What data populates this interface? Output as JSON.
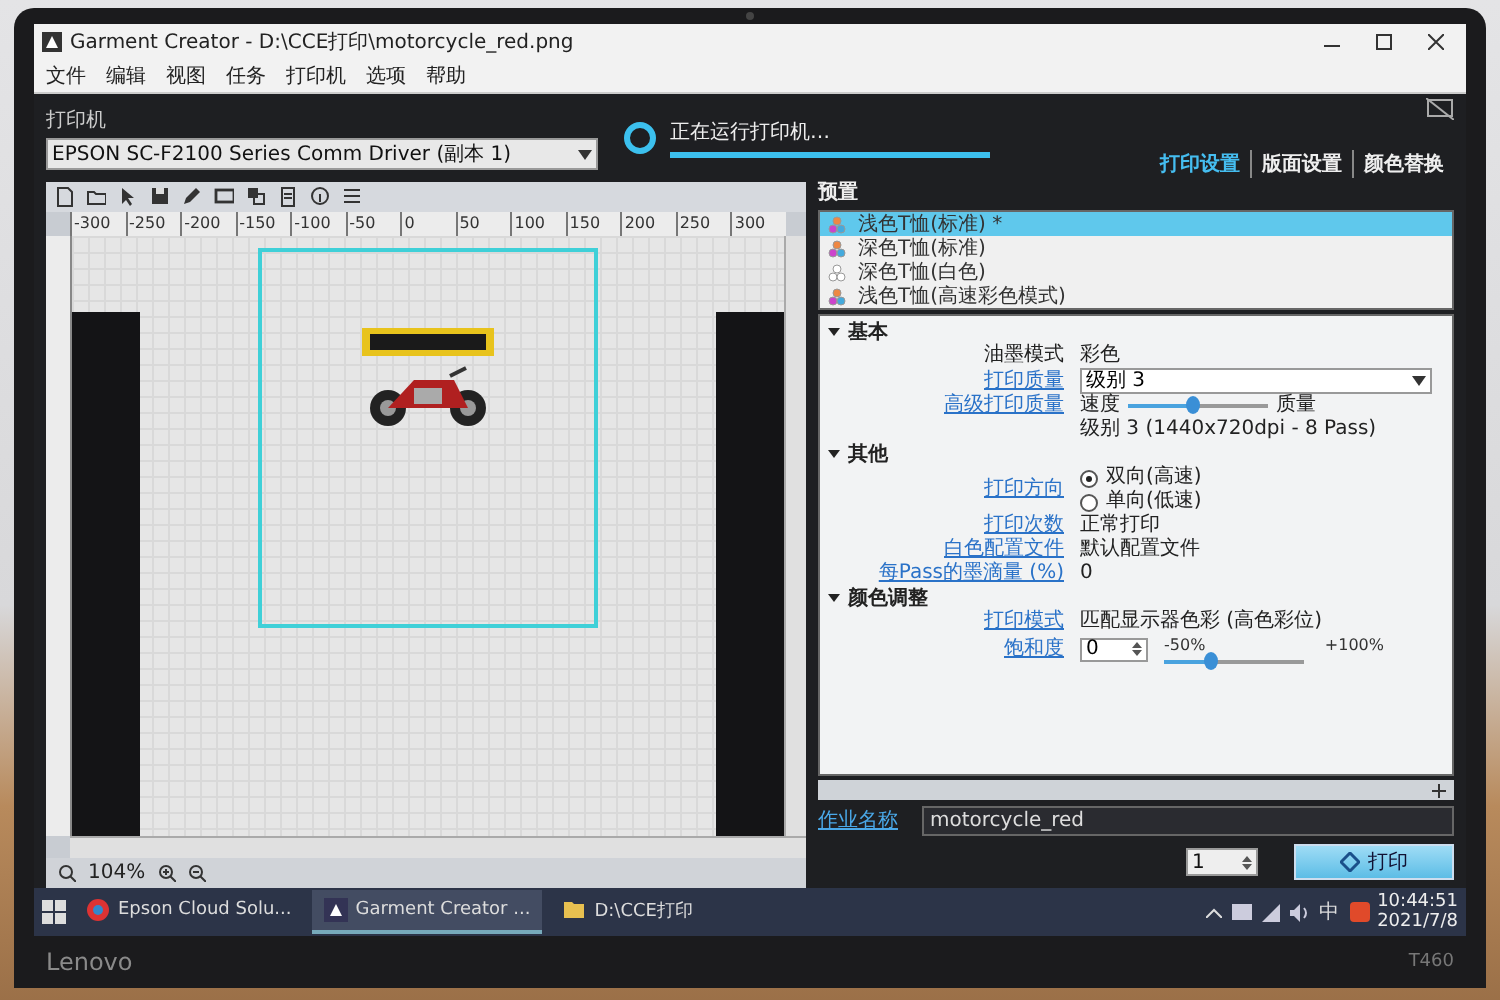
{
  "laptop": {
    "brand": "Lenovo",
    "model": "T460"
  },
  "window": {
    "title": "Garment Creator - D:\\CCE打印\\motorcycle_red.png"
  },
  "menu": [
    "文件",
    "编辑",
    "视图",
    "任务",
    "打印机",
    "选项",
    "帮助"
  ],
  "printer": {
    "label": "打印机",
    "value": "EPSON SC-F2100 Series Comm Driver (副本 1)"
  },
  "progress": {
    "text": "正在运行打印机…",
    "level": 1
  },
  "tabs": [
    {
      "label": "打印设置",
      "selected": true
    },
    {
      "label": "版面设置",
      "selected": false
    },
    {
      "label": "颜色替换",
      "selected": false
    }
  ],
  "canvas": {
    "ruler": [
      "-300",
      "-250",
      "-200",
      "-150",
      "-100",
      "-50",
      "0",
      "50",
      "100",
      "150",
      "200",
      "250",
      "300"
    ],
    "zoom": "104%"
  },
  "presets": {
    "label": "预置",
    "items": [
      {
        "label": "浅色T恤(标准) *",
        "selected": true
      },
      {
        "label": "深色T恤(标准)",
        "selected": false
      },
      {
        "label": "深色T恤(白色)",
        "selected": false
      },
      {
        "label": "浅色T恤(高速彩色模式)",
        "selected": false
      }
    ]
  },
  "settings": [
    {
      "title": "基本",
      "expanded": true,
      "rows": [
        {
          "kind": "text",
          "link": false,
          "label": "油墨模式",
          "value": "彩色"
        },
        {
          "kind": "select",
          "link": true,
          "label": "打印质量",
          "value": "级别 3"
        },
        {
          "kind": "slider",
          "link": true,
          "label": "高级打印质量",
          "min_label": "速度",
          "max_label": "质量",
          "level": 0.45
        },
        {
          "kind": "note",
          "value": "级别 3 (1440x720dpi - 8 Pass)"
        }
      ]
    },
    {
      "title": "其他",
      "expanded": true,
      "rows": [
        {
          "kind": "radio",
          "link": true,
          "label": "打印方向",
          "options": [
            {
              "label": "双向(高速)",
              "selected": true
            },
            {
              "label": "单向(低速)",
              "selected": false
            }
          ]
        },
        {
          "kind": "text",
          "link": true,
          "label": "打印次数",
          "value": "正常打印"
        },
        {
          "kind": "text",
          "link": true,
          "label": "白色配置文件",
          "value": "默认配置文件"
        },
        {
          "kind": "text",
          "link": true,
          "label": "每Pass的墨滴量 (%)",
          "value": "0"
        }
      ]
    },
    {
      "title": "颜色调整",
      "expanded": true,
      "rows": [
        {
          "kind": "text",
          "link": true,
          "label": "打印模式",
          "value": "匹配显示器色彩 (高色彩位)"
        },
        {
          "kind": "spin-slider",
          "link": true,
          "label": "饱和度",
          "value": "0",
          "min_label": "-50%",
          "max_label": "+100%",
          "level": 0.33
        }
      ]
    }
  ],
  "job": {
    "label": "作业名称",
    "value": "motorcycle_red"
  },
  "copies": "1",
  "print_button": "打印",
  "taskbar": {
    "items": [
      {
        "label": "Epson Cloud Solu...",
        "active": false
      },
      {
        "label": "Garment Creator ...",
        "active": true
      },
      {
        "label": "D:\\CCE打印",
        "active": false
      }
    ],
    "ime": "中",
    "time": "10:44:51",
    "date": "2021/7/8"
  }
}
